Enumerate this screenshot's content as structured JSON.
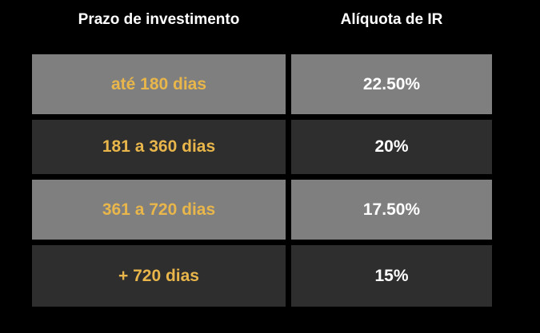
{
  "colors": {
    "background": "#000000",
    "row_light": "#7f7f7f",
    "row_dark": "#2e2e2e",
    "term_text": "#e8b64a",
    "rate_text": "#ffffff",
    "header_text": "#ffffff"
  },
  "table": {
    "headers": [
      "Prazo de investimento",
      "Alíquota de IR"
    ],
    "rows": [
      {
        "term": "até 180 dias",
        "rate": "22.50%"
      },
      {
        "term": "181 a 360 dias",
        "rate": "20%"
      },
      {
        "term": "361 a 720 dias",
        "rate": "17.50%"
      },
      {
        "term": "+ 720 dias",
        "rate": "15%"
      }
    ]
  }
}
